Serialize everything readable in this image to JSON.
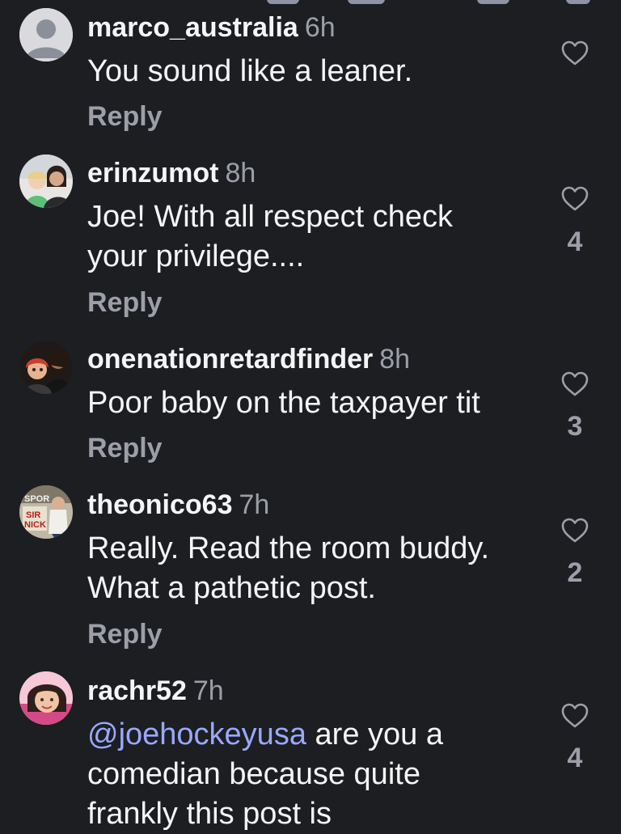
{
  "comments": [
    {
      "username": "marco_australia",
      "time": "6h",
      "text": "You sound like a leaner.",
      "reply_label": "Reply",
      "like_count": ""
    },
    {
      "username": "erinzumot",
      "time": "8h",
      "text_line1": "Joe! With all respect check",
      "text_line2": "your privilege....",
      "reply_label": "Reply",
      "like_count": "4"
    },
    {
      "username": "onenationretardfinder",
      "time": "8h",
      "text": "Poor baby on the taxpayer tit",
      "reply_label": "Reply",
      "like_count": "3"
    },
    {
      "username": "theonico63",
      "time": "7h",
      "text_line1": "Really. Read the room buddy.",
      "text_line2": "What a pathetic post.",
      "reply_label": "Reply",
      "like_count": "2",
      "avatar_text_top": "SPOR",
      "avatar_text_mid": "SIR",
      "avatar_text_bot": "NICK"
    },
    {
      "username": "rachr52",
      "time": "7h",
      "mention": "@joehockeyusa",
      "text_line1_rest": " are you a",
      "text_line2": "comedian because quite",
      "text_line3": "frankly this post is",
      "like_count": "4"
    }
  ],
  "colors": {
    "background": "#1c1e21",
    "text": "#f5f5f7",
    "muted": "#9c9fa8",
    "mention": "#9aa8ff"
  },
  "icons": {
    "like": "heart-outline-icon",
    "default_avatar": "default-user-avatar-icon"
  }
}
